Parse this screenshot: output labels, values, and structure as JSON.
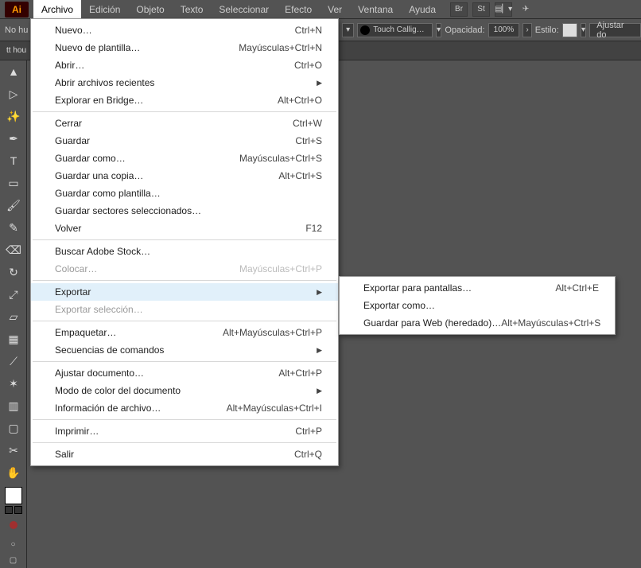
{
  "app": {
    "logo": "Ai"
  },
  "menubar": {
    "items": [
      "Archivo",
      "Edición",
      "Objeto",
      "Texto",
      "Seleccionar",
      "Efecto",
      "Ver",
      "Ventana",
      "Ayuda"
    ],
    "active": "Archivo",
    "right_icons": [
      "Br",
      "St"
    ]
  },
  "propbar": {
    "left": "No hu",
    "brush": "Touch Callig…",
    "opacity_label": "Opacidad:",
    "opacity_value": "100%",
    "style_label": "Estilo:",
    "adjust": "Ajustar do"
  },
  "tab": {
    "label": "tt hou"
  },
  "file_menu": {
    "groups": [
      [
        {
          "label": "Nuevo…",
          "shortcut": "Ctrl+N"
        },
        {
          "label": "Nuevo de plantilla…",
          "shortcut": "Mayúsculas+Ctrl+N"
        },
        {
          "label": "Abrir…",
          "shortcut": "Ctrl+O"
        },
        {
          "label": "Abrir archivos recientes",
          "submenu": true
        },
        {
          "label": "Explorar en Bridge…",
          "shortcut": "Alt+Ctrl+O"
        }
      ],
      [
        {
          "label": "Cerrar",
          "shortcut": "Ctrl+W"
        },
        {
          "label": "Guardar",
          "shortcut": "Ctrl+S"
        },
        {
          "label": "Guardar como…",
          "shortcut": "Mayúsculas+Ctrl+S"
        },
        {
          "label": "Guardar una copia…",
          "shortcut": "Alt+Ctrl+S"
        },
        {
          "label": "Guardar como plantilla…"
        },
        {
          "label": "Guardar sectores seleccionados…"
        },
        {
          "label": "Volver",
          "shortcut": "F12"
        }
      ],
      [
        {
          "label": "Buscar Adobe Stock…"
        },
        {
          "label": "Colocar…",
          "shortcut": "Mayúsculas+Ctrl+P",
          "disabled": true
        }
      ],
      [
        {
          "label": "Exportar",
          "submenu": true,
          "highlight": true
        },
        {
          "label": "Exportar selección…",
          "disabled": true
        }
      ],
      [
        {
          "label": "Empaquetar…",
          "shortcut": "Alt+Mayúsculas+Ctrl+P"
        },
        {
          "label": "Secuencias de comandos",
          "submenu": true
        }
      ],
      [
        {
          "label": "Ajustar documento…",
          "shortcut": "Alt+Ctrl+P"
        },
        {
          "label": "Modo de color del documento",
          "submenu": true
        },
        {
          "label": "Información de archivo…",
          "shortcut": "Alt+Mayúsculas+Ctrl+I"
        }
      ],
      [
        {
          "label": "Imprimir…",
          "shortcut": "Ctrl+P"
        }
      ],
      [
        {
          "label": "Salir",
          "shortcut": "Ctrl+Q"
        }
      ]
    ]
  },
  "export_submenu": [
    {
      "label": "Exportar para pantallas…",
      "shortcut": "Alt+Ctrl+E"
    },
    {
      "label": "Exportar como…"
    },
    {
      "label": "Guardar para Web (heredado)…",
      "shortcut": "Alt+Mayúsculas+Ctrl+S"
    }
  ],
  "tools": [
    "selection",
    "direct",
    "magic",
    "pen",
    "type",
    "rect",
    "brush",
    "pencil",
    "eraser",
    "rotate",
    "scale",
    "perspective",
    "mesh",
    "eyedropper",
    "symbol",
    "graph",
    "artboard",
    "slice",
    "hand"
  ]
}
